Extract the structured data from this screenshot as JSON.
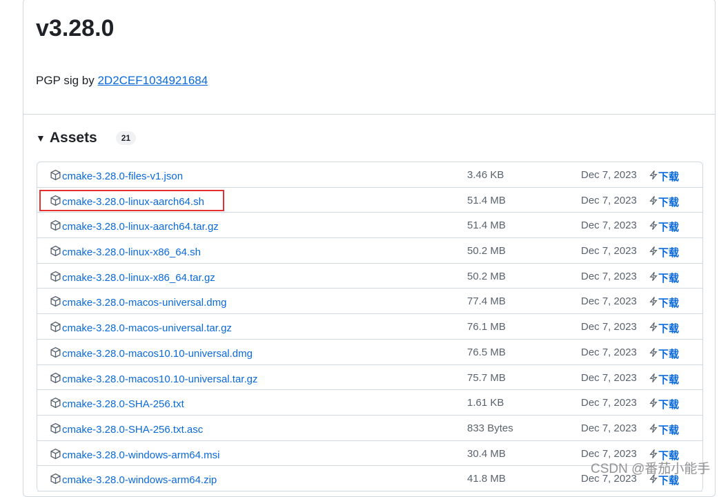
{
  "release": {
    "title": "v3.28.0",
    "pgp_prefix": "PGP sig by",
    "pgp_key": "2D2CEF1034921684"
  },
  "assets": {
    "label": "Assets",
    "count": "21",
    "download_label": "下载",
    "rows": [
      {
        "name": "cmake-3.28.0-files-v1.json",
        "size": "3.46 KB",
        "date": "Dec 7, 2023"
      },
      {
        "name": "cmake-3.28.0-linux-aarch64.sh",
        "size": "51.4 MB",
        "date": "Dec 7, 2023"
      },
      {
        "name": "cmake-3.28.0-linux-aarch64.tar.gz",
        "size": "51.4 MB",
        "date": "Dec 7, 2023"
      },
      {
        "name": "cmake-3.28.0-linux-x86_64.sh",
        "size": "50.2 MB",
        "date": "Dec 7, 2023"
      },
      {
        "name": "cmake-3.28.0-linux-x86_64.tar.gz",
        "size": "50.2 MB",
        "date": "Dec 7, 2023"
      },
      {
        "name": "cmake-3.28.0-macos-universal.dmg",
        "size": "77.4 MB",
        "date": "Dec 7, 2023"
      },
      {
        "name": "cmake-3.28.0-macos-universal.tar.gz",
        "size": "76.1 MB",
        "date": "Dec 7, 2023"
      },
      {
        "name": "cmake-3.28.0-macos10.10-universal.dmg",
        "size": "76.5 MB",
        "date": "Dec 7, 2023"
      },
      {
        "name": "cmake-3.28.0-macos10.10-universal.tar.gz",
        "size": "75.7 MB",
        "date": "Dec 7, 2023"
      },
      {
        "name": "cmake-3.28.0-SHA-256.txt",
        "size": "1.61 KB",
        "date": "Dec 7, 2023"
      },
      {
        "name": "cmake-3.28.0-SHA-256.txt.asc",
        "size": "833 Bytes",
        "date": "Dec 7, 2023"
      },
      {
        "name": "cmake-3.28.0-windows-arm64.msi",
        "size": "30.4 MB",
        "date": "Dec 7, 2023"
      },
      {
        "name": "cmake-3.28.0-windows-arm64.zip",
        "size": "41.8 MB",
        "date": "Dec 7, 2023"
      }
    ]
  },
  "watermark": "CSDN @番茄小能手",
  "colors": {
    "link": "#0969da",
    "highlight": "#e5302f"
  }
}
